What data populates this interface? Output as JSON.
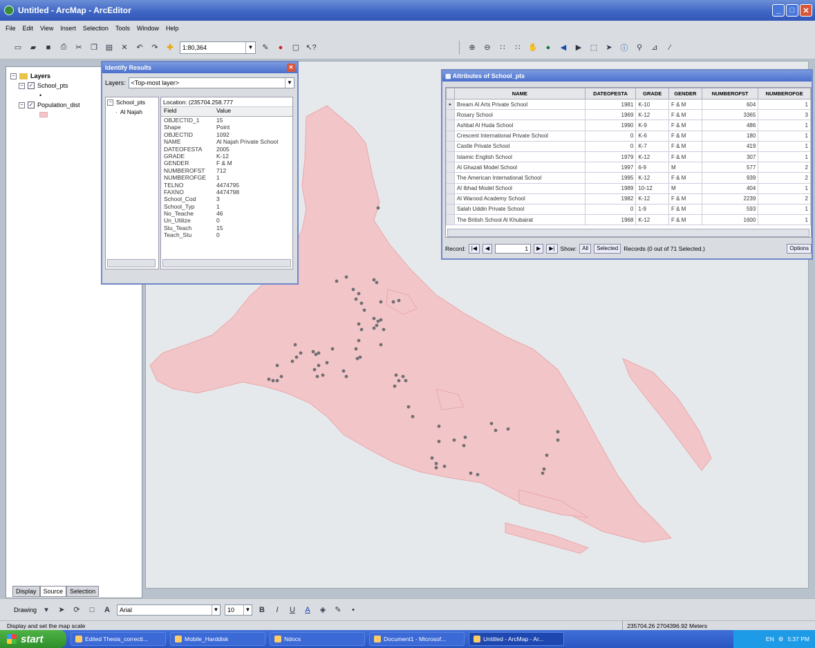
{
  "window": {
    "title": "Untitled - ArcMap - ArcEditor"
  },
  "menu": [
    "File",
    "Edit",
    "View",
    "Insert",
    "Selection",
    "Tools",
    "Window",
    "Help"
  ],
  "toolbar": {
    "scale": "1:80,364"
  },
  "toc": {
    "root": "Layers",
    "layers": [
      {
        "name": "School_pts",
        "checked": true
      },
      {
        "name": "Population_dist",
        "checked": true
      }
    ],
    "tabs": [
      "Display",
      "Source",
      "Selection"
    ]
  },
  "identify": {
    "title": "Identify Results",
    "layers_label": "Layers:",
    "layers_value": "<Top-most layer>",
    "tree_root": "School_pts",
    "tree_child": "Al Najah",
    "location": "Location: (235704.258.777",
    "field_header": "Field",
    "value_header": "Value",
    "fields": [
      {
        "field": "OBJECTID_1",
        "value": "15"
      },
      {
        "field": "Shape",
        "value": "Point"
      },
      {
        "field": "OBJECTID",
        "value": "1092"
      },
      {
        "field": "NAME",
        "value": "Al Najah Private School"
      },
      {
        "field": "DATEOFESTA",
        "value": "2005"
      },
      {
        "field": "GRADE",
        "value": "K-12"
      },
      {
        "field": "GENDER",
        "value": "F & M"
      },
      {
        "field": "NUMBEROFST",
        "value": "712"
      },
      {
        "field": "NUMBEROFGE",
        "value": "1"
      },
      {
        "field": "TELNO",
        "value": "4474795"
      },
      {
        "field": "FAXNO",
        "value": "4474798"
      },
      {
        "field": "School_Cod",
        "value": "3"
      },
      {
        "field": "School_Typ",
        "value": "1"
      },
      {
        "field": "No_Teache",
        "value": "46"
      },
      {
        "field": "Un_Utilize",
        "value": "0"
      },
      {
        "field": "Stu_Teach",
        "value": "15"
      },
      {
        "field": "Teach_Stu",
        "value": "0"
      }
    ]
  },
  "attributes": {
    "title": "Attributes of School_pts",
    "columns": [
      "NAME",
      "DATEOFESTA",
      "GRADE",
      "GENDER",
      "NUMBEROFST",
      "NUMBEROFGE"
    ],
    "rows": [
      [
        "Bream Al Arts Private School",
        "1981",
        "K-10",
        "F & M",
        "604",
        "1"
      ],
      [
        "Rosary School",
        "1969",
        "K-12",
        "F & M",
        "3365",
        "3"
      ],
      [
        "Ashbal Al Huda School",
        "1990",
        "K-9",
        "F & M",
        "486",
        "1"
      ],
      [
        "Crescent International Private School",
        "0",
        "K-6",
        "F & M",
        "180",
        "1"
      ],
      [
        "Castle Private School",
        "0",
        "K-7",
        "F & M",
        "419",
        "1"
      ],
      [
        "Islamic English School",
        "1979",
        "K-12",
        "F & M",
        "307",
        "1"
      ],
      [
        "Al Ghazali Model School",
        "1997",
        "6-9",
        "M",
        "577",
        "2"
      ],
      [
        "The American International School",
        "1995",
        "K-12",
        "F & M",
        "939",
        "2"
      ],
      [
        "Al Ibhad Model School",
        "1989",
        "10-12",
        "M",
        "404",
        "1"
      ],
      [
        "Al Warood Academy School",
        "1982",
        "K-12",
        "F & M",
        "2239",
        "2"
      ],
      [
        "Salah Uddin Private School",
        "0",
        "1-9",
        "F & M",
        "593",
        "1"
      ],
      [
        "The British School Al Khubairat",
        "1968",
        "K-12",
        "F & M",
        "1600",
        "1"
      ]
    ],
    "nav": {
      "record_label": "Record:",
      "record_value": "1",
      "show_label": "Show:",
      "all": "All",
      "selected": "Selected",
      "summary": "Records (0 out of 71 Selected.)",
      "options": "Options"
    }
  },
  "drawing": {
    "label": "Drawing",
    "font": "Arial",
    "size": "10"
  },
  "status": {
    "message": "Display and set the map scale",
    "coords": "235704.26  2704396.92 Meters"
  },
  "taskbar": {
    "start": "start",
    "items": [
      "Edited Thesis_correcti...",
      "Mobile_Harddisk",
      "Ndocs",
      "Document1 - Microsof...",
      "Untitled - ArcMap - Ar..."
    ],
    "lang": "EN",
    "time": "5:37 PM"
  },
  "colors": {
    "map_fill": "#f2c6c8",
    "map_stroke": "#e8a7ab",
    "point": "#6e6e73",
    "title_blue": "#3d64c4"
  }
}
